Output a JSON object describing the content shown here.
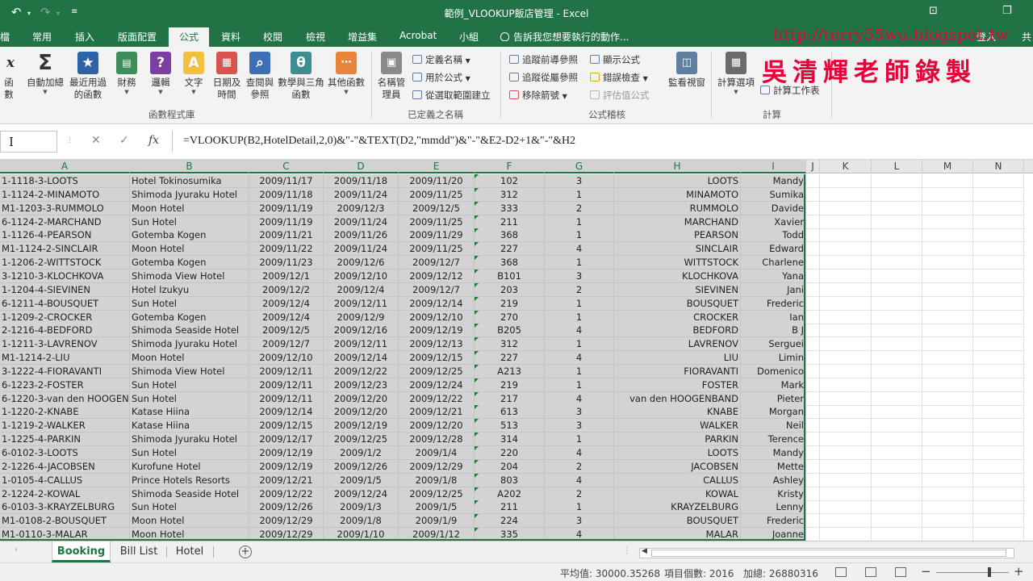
{
  "window": {
    "title": "範例_VLOOKUP飯店管理 - Excel",
    "undo_icon": "undo-icon",
    "redo_icon": "redo-icon",
    "customize_icon": "customize-quick-access-icon",
    "share_label": "共"
  },
  "tabs": [
    {
      "label": "常用"
    },
    {
      "label": "插入"
    },
    {
      "label": "版面配置"
    },
    {
      "label": "公式",
      "active": true
    },
    {
      "label": "資料"
    },
    {
      "label": "校閱"
    },
    {
      "label": "檢視"
    },
    {
      "label": "增益集"
    },
    {
      "label": "Acrobat"
    },
    {
      "label": "小組"
    }
  ],
  "tellme": "告訴我您想要執行的動作...",
  "signin": "登入",
  "watermark": {
    "url": "http://terry55wu.blogspot.tw",
    "name": "吳清輝老師錄製"
  },
  "ribbon": {
    "library": {
      "label": "函數程式庫",
      "buttons": [
        {
          "label": "函數",
          "icon": "fx-icon"
        },
        {
          "label": "自動加總",
          "icon": "sigma-icon"
        },
        {
          "label": "最近用過的函數",
          "icon": "star-icon"
        },
        {
          "label": "財務",
          "icon": "finance-icon"
        },
        {
          "label": "邏輯",
          "icon": "logic-icon"
        },
        {
          "label": "文字",
          "icon": "text-icon"
        },
        {
          "label": "日期及時間",
          "icon": "calendar-icon"
        },
        {
          "label": "查閱與參照",
          "icon": "lookup-icon"
        },
        {
          "label": "數學與三角函數",
          "icon": "math-icon"
        },
        {
          "label": "其他函數",
          "icon": "more-functions-icon"
        }
      ]
    },
    "names": {
      "label": "已定義之名稱",
      "manager": "名稱管理員",
      "define": "定義名稱",
      "use": "用於公式",
      "create": "從選取範圍建立"
    },
    "audit": {
      "label": "公式稽核",
      "trace_prec": "追蹤前導參照",
      "trace_dep": "追蹤從屬參照",
      "remove": "移除箭號",
      "show": "顯示公式",
      "check": "錯誤檢查",
      "evaluate": "評估值公式",
      "watch": "監看視窗"
    },
    "calc": {
      "label": "計算",
      "options": "計算選項",
      "sheet": "計算工作表"
    }
  },
  "formula_bar": {
    "formula": "=VLOOKUP(B2,HotelDetail,2,0)&\"-\"&TEXT(D2,\"mmdd\")&\"-\"&E2-D2+1&\"-\"&H2"
  },
  "columns": [
    "A",
    "B",
    "C",
    "D",
    "E",
    "F",
    "G",
    "H",
    "I",
    "J",
    "K",
    "L",
    "M",
    "N"
  ],
  "rows": [
    [
      "1-1118-3-LOOTS",
      "Hotel Tokinosumika",
      "2009/11/17",
      "2009/11/18",
      "2009/11/20",
      "102",
      "3",
      "LOOTS",
      "Mandy"
    ],
    [
      "1-1124-2-MINAMOTO",
      "Shimoda Jyuraku Hotel",
      "2009/11/18",
      "2009/11/24",
      "2009/11/25",
      "312",
      "1",
      "MINAMOTO",
      "Sumika"
    ],
    [
      "M1-1203-3-RUMMOLO",
      "Moon Hotel",
      "2009/11/19",
      "2009/12/3",
      "2009/12/5",
      "333",
      "2",
      "RUMMOLO",
      "Davide"
    ],
    [
      "6-1124-2-MARCHAND",
      "Sun Hotel",
      "2009/11/19",
      "2009/11/24",
      "2009/11/25",
      "211",
      "1",
      "MARCHAND",
      "Xavier"
    ],
    [
      "1-1126-4-PEARSON",
      "Gotemba Kogen",
      "2009/11/21",
      "2009/11/26",
      "2009/11/29",
      "368",
      "1",
      "PEARSON",
      "Todd"
    ],
    [
      "M1-1124-2-SINCLAIR",
      "Moon Hotel",
      "2009/11/22",
      "2009/11/24",
      "2009/11/25",
      "227",
      "4",
      "SINCLAIR",
      "Edward"
    ],
    [
      "1-1206-2-WITTSTOCK",
      "Gotemba Kogen",
      "2009/11/23",
      "2009/12/6",
      "2009/12/7",
      "368",
      "1",
      "WITTSTOCK",
      "Charlene"
    ],
    [
      "3-1210-3-KLOCHKOVA",
      "Shimoda View Hotel",
      "2009/12/1",
      "2009/12/10",
      "2009/12/12",
      "B101",
      "3",
      "KLOCHKOVA",
      "Yana"
    ],
    [
      "1-1204-4-SIEVINEN",
      "Hotel Izukyu",
      "2009/12/2",
      "2009/12/4",
      "2009/12/7",
      "203",
      "2",
      "SIEVINEN",
      "Jani"
    ],
    [
      "6-1211-4-BOUSQUET",
      "Sun Hotel",
      "2009/12/4",
      "2009/12/11",
      "2009/12/14",
      "219",
      "1",
      "BOUSQUET",
      "Frederic"
    ],
    [
      "1-1209-2-CROCKER",
      "Gotemba Kogen",
      "2009/12/4",
      "2009/12/9",
      "2009/12/10",
      "270",
      "1",
      "CROCKER",
      "Ian"
    ],
    [
      "2-1216-4-BEDFORD",
      "Shimoda Seaside Hotel",
      "2009/12/5",
      "2009/12/16",
      "2009/12/19",
      "B205",
      "4",
      "BEDFORD",
      "B J"
    ],
    [
      "1-1211-3-LAVRENOV",
      "Shimoda Jyuraku Hotel",
      "2009/12/7",
      "2009/12/11",
      "2009/12/13",
      "312",
      "1",
      "LAVRENOV",
      "Serguei"
    ],
    [
      "M1-1214-2-LIU",
      "Moon Hotel",
      "2009/12/10",
      "2009/12/14",
      "2009/12/15",
      "227",
      "4",
      "LIU",
      "Limin"
    ],
    [
      "3-1222-4-FIORAVANTI",
      "Shimoda View Hotel",
      "2009/12/11",
      "2009/12/22",
      "2009/12/25",
      "A213",
      "1",
      "FIORAVANTI",
      "Domenico"
    ],
    [
      "6-1223-2-FOSTER",
      "Sun Hotel",
      "2009/12/11",
      "2009/12/23",
      "2009/12/24",
      "219",
      "1",
      "FOSTER",
      "Mark"
    ],
    [
      "6-1220-3-van den HOOGENBA",
      "Sun Hotel",
      "2009/12/11",
      "2009/12/20",
      "2009/12/22",
      "217",
      "4",
      "van den HOOGENBAND",
      "Pieter"
    ],
    [
      "1-1220-2-KNABE",
      "Katase Hiina",
      "2009/12/14",
      "2009/12/20",
      "2009/12/21",
      "613",
      "3",
      "KNABE",
      "Morgan"
    ],
    [
      "1-1219-2-WALKER",
      "Katase Hiina",
      "2009/12/15",
      "2009/12/19",
      "2009/12/20",
      "513",
      "3",
      "WALKER",
      "Neil"
    ],
    [
      "1-1225-4-PARKIN",
      "Shimoda Jyuraku Hotel",
      "2009/12/17",
      "2009/12/25",
      "2009/12/28",
      "314",
      "1",
      "PARKIN",
      "Terence"
    ],
    [
      "6-0102-3-LOOTS",
      "Sun Hotel",
      "2009/12/19",
      "2009/1/2",
      "2009/1/4",
      "220",
      "4",
      "LOOTS",
      "Mandy"
    ],
    [
      "2-1226-4-JACOBSEN",
      "Kurofune Hotel",
      "2009/12/19",
      "2009/12/26",
      "2009/12/29",
      "204",
      "2",
      "JACOBSEN",
      "Mette"
    ],
    [
      "1-0105-4-CALLUS",
      "Prince Hotels Resorts",
      "2009/12/21",
      "2009/1/5",
      "2009/1/8",
      "803",
      "4",
      "CALLUS",
      "Ashley"
    ],
    [
      "2-1224-2-KOWAL",
      "Shimoda Seaside Hotel",
      "2009/12/22",
      "2009/12/24",
      "2009/12/25",
      "A202",
      "2",
      "KOWAL",
      "Kristy"
    ],
    [
      "6-0103-3-KRAYZELBURG",
      "Sun Hotel",
      "2009/12/26",
      "2009/1/3",
      "2009/1/5",
      "211",
      "1",
      "KRAYZELBURG",
      "Lenny"
    ],
    [
      "M1-0108-2-BOUSQUET",
      "Moon Hotel",
      "2009/12/29",
      "2009/1/8",
      "2009/1/9",
      "224",
      "3",
      "BOUSQUET",
      "Frederic"
    ],
    [
      "M1-0110-3-MALAR",
      "Moon Hotel",
      "2009/12/29",
      "2009/1/10",
      "2009/1/12",
      "335",
      "4",
      "MALAR",
      "Joanne"
    ]
  ],
  "sheets": [
    {
      "label": "Booking",
      "active": true
    },
    {
      "label": "Bill List"
    },
    {
      "label": "Hotel"
    }
  ],
  "status": {
    "average": "平均值: 30000.35268",
    "count": "項目個數: 2016",
    "sum": "加總: 26880316"
  }
}
